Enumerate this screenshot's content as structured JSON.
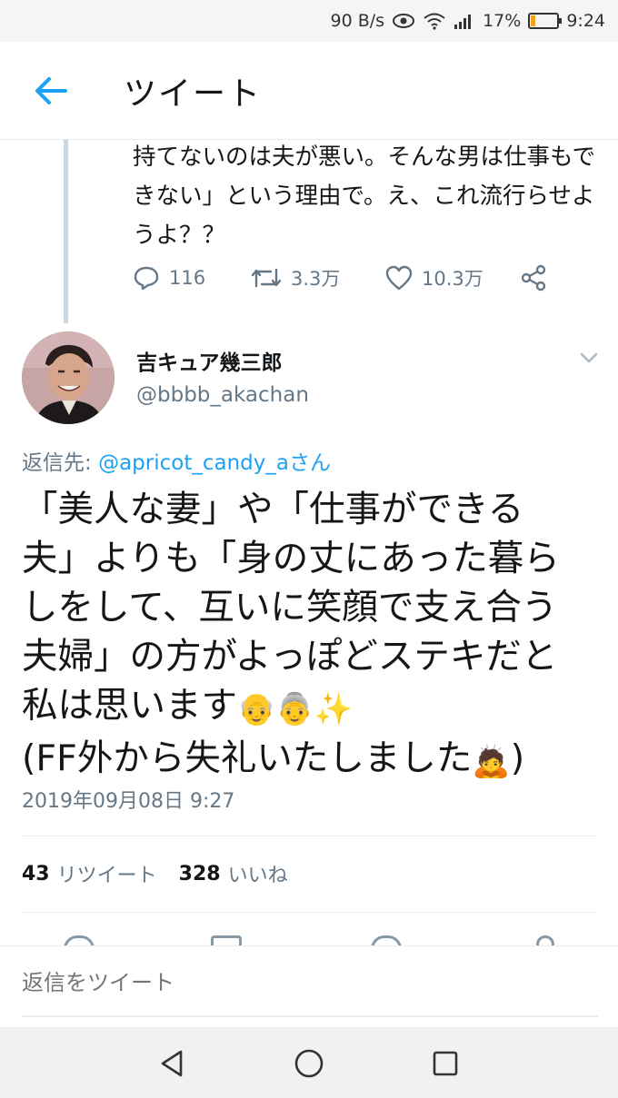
{
  "status_bar": {
    "net_speed": "90 B/s",
    "battery_percent_text": "17%",
    "battery_level": 0.17,
    "time": "9:24",
    "icons": [
      "eye-icon",
      "wifi-icon",
      "signal-icon",
      "battery-icon"
    ]
  },
  "header": {
    "title": "ツイート",
    "back_icon": "arrow-left-icon"
  },
  "previous_tweet": {
    "text": "持てないのは夫が悪い。そんな男は仕事もできない」という理由で。え、これ流行らせようよ？？",
    "reply_count": "116",
    "retweet_count": "3.3万",
    "like_count": "10.3万"
  },
  "tweet": {
    "display_name": "吉キュア幾三郎",
    "handle": "@bbbb_akachan",
    "reply_to_prefix": "返信先: ",
    "reply_to_user": "@apricot_candy_aさん",
    "body_lines": [
      "「美人な妻」や「仕事ができる",
      "夫」よりも「身の丈にあった暮ら",
      "しをして、互いに笑顔で支え合う",
      "夫婦」の方がよっぽどステキだと",
      "私は思います",
      "(FF外から失礼いたしました"
    ],
    "emoji_line5": [
      "👴",
      "👵",
      "✨"
    ],
    "emoji_line6": "🙇",
    "body_tail": ")",
    "timestamp": "2019年09月08日 9:27",
    "retweet_count": "43",
    "retweet_label": "リツイート",
    "like_count": "328",
    "like_label": "いいね"
  },
  "reply_bar": {
    "placeholder": "返信をツイート"
  },
  "colors": {
    "accent": "#1da1f2",
    "secondary_text": "#657786",
    "divider": "#e6ecf0"
  }
}
